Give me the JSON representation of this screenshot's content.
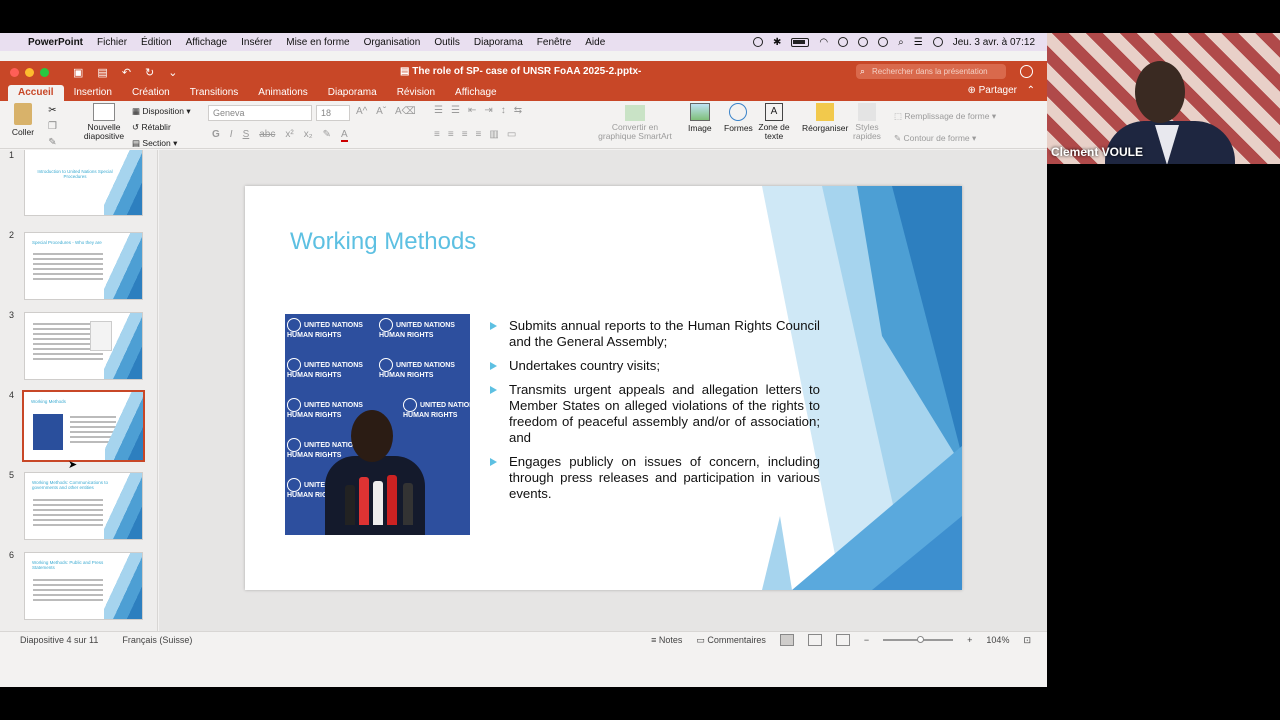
{
  "menubar": {
    "apple": "",
    "app_name": "PowerPoint",
    "items": [
      "Fichier",
      "Édition",
      "Affichage",
      "Insérer",
      "Mise en forme",
      "Organisation",
      "Outils",
      "Diaporama",
      "Fenêtre",
      "Aide"
    ],
    "clock": "Jeu. 3 avr. à  07:12"
  },
  "window": {
    "doc_title": "The role of SP- case of UNSR FoAA 2025-2.pptx-",
    "search_placeholder": "Rechercher dans la présentation",
    "traffic_colors": [
      "#ff5f57",
      "#febc2e",
      "#28c840"
    ]
  },
  "tabs": {
    "items": [
      "Accueil",
      "Insertion",
      "Création",
      "Transitions",
      "Animations",
      "Diaporama",
      "Révision",
      "Affichage"
    ],
    "active": "Accueil",
    "share": "Partager"
  },
  "ribbon": {
    "paste": "Coller",
    "new_slide": "Nouvelle diapositive",
    "layout": "Disposition",
    "reset": "Rétablir",
    "section": "Section",
    "font_name": "Geneva",
    "font_size": "18",
    "smartart": "Convertir en graphique SmartArt",
    "image": "Image",
    "shapes": "Formes",
    "textbox": "Zone de texte",
    "arrange": "Réorganiser",
    "quick_styles": "Styles rapides",
    "shape_fill": "Remplissage de forme",
    "shape_outline": "Contour de forme"
  },
  "thumbnails": [
    {
      "num": "1",
      "title": "Introduction to United Nations Special Procedures",
      "selected": false
    },
    {
      "num": "2",
      "title": "Special Procedures - Who they are",
      "selected": false
    },
    {
      "num": "3",
      "title": "",
      "selected": false
    },
    {
      "num": "4",
      "title": "Working Methods",
      "selected": true
    },
    {
      "num": "5",
      "title": "Working Methods: Communications to governments and other entities",
      "selected": false
    },
    {
      "num": "6",
      "title": "Working Methods: Public and Press Statements",
      "selected": false
    }
  ],
  "slide": {
    "title": "Working Methods",
    "photo_banner": "UNITED NATIONS HUMAN RIGHTS",
    "bullets": [
      "Submits annual reports to the Human Rights Council and the General Assembly;",
      "Undertakes country visits;",
      "Transmits urgent appeals and allegation letters to Member States on alleged violations of the rights to freedom of peaceful assembly and/or of association; and",
      "Engages publicly on issues of concern, including through press releases and participation in various events."
    ],
    "accent": "#5dc0e2"
  },
  "statusbar": {
    "slide_info": "Diapositive 4 sur 11",
    "language": "Français (Suisse)",
    "notes": "Notes",
    "comments": "Commentaires",
    "zoom": "104%"
  },
  "camera": {
    "name": "Clement VOULE"
  },
  "colors": {
    "ppt_red": "#c84727",
    "slide_blue_light": "#a6d4ee",
    "slide_blue_dark": "#2d7fbf"
  }
}
